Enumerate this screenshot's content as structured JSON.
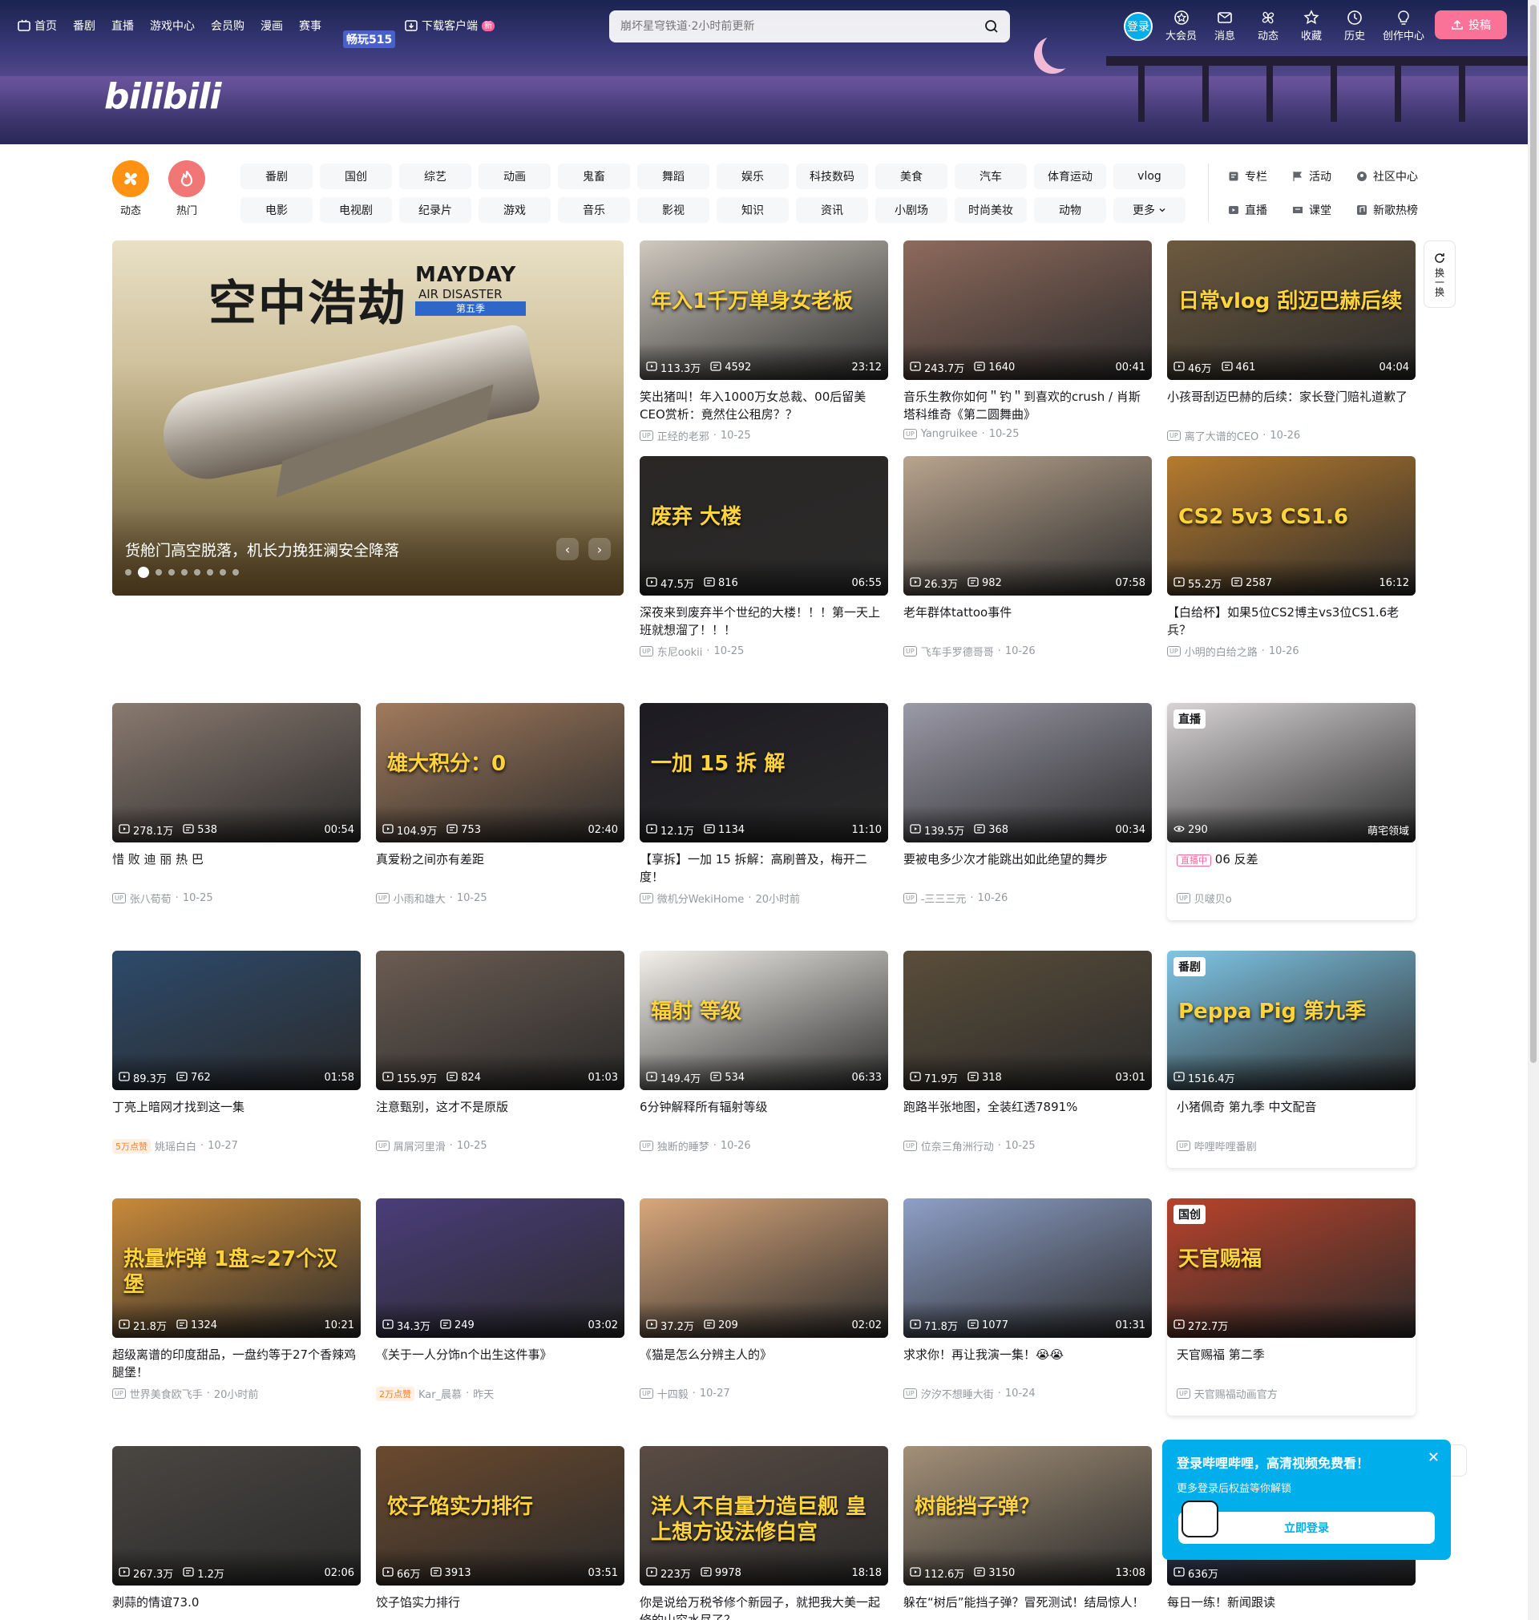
{
  "topnav": {
    "items": [
      "首页",
      "番剧",
      "直播",
      "游戏中心",
      "会员购",
      "漫画",
      "赛事"
    ],
    "event_logo": "畅玩515",
    "download": "下载客户端",
    "download_badge": "新"
  },
  "banner": {
    "logo": "bilibili"
  },
  "search": {
    "placeholder": "崩坏星穹铁道·2小时前更新"
  },
  "right_nav": {
    "login": "登录",
    "items": [
      "大会员",
      "消息",
      "动态",
      "收藏",
      "历史",
      "创作中心"
    ],
    "upload": "投稿"
  },
  "channels": {
    "main": [
      "动态",
      "热门"
    ],
    "tags": [
      "番剧",
      "国创",
      "综艺",
      "动画",
      "鬼畜",
      "舞蹈",
      "娱乐",
      "科技数码",
      "美食",
      "汽车",
      "体育运动",
      "vlog",
      "电影",
      "电视剧",
      "纪录片",
      "游戏",
      "音乐",
      "影视",
      "知识",
      "资讯",
      "小剧场",
      "时尚美妆",
      "动物",
      "更多"
    ],
    "side": [
      "专栏",
      "活动",
      "社区中心",
      "直播",
      "课堂",
      "新歌热榜"
    ]
  },
  "carousel": {
    "title_cn": "空中浩劫",
    "mayday": "MAYDAY",
    "air_disaster": "AIR DISASTER",
    "season": "第五季",
    "caption": "货舱门高空脱落，机长力挽狂澜安全降落",
    "active_dot": 1,
    "dot_count": 9
  },
  "refresh": {
    "label": "换一换"
  },
  "cards": [
    {
      "views": "113.3万",
      "danmaku": "4592",
      "duration": "23:12",
      "title": "笑出猪叫！年入1000万女总裁、00后留美CEO赏析：竟然住公租房？？",
      "up": "正经的老邪",
      "date": "10-25",
      "overlay": "年入1千万单身女老板",
      "color": "#cfc9bf"
    },
    {
      "views": "243.7万",
      "danmaku": "1640",
      "duration": "00:41",
      "title": "音乐生教你如何＂钓＂到喜欢的crush / 肖斯塔科维奇《第二圆舞曲》",
      "up": "Yangruikee",
      "date": "10-25",
      "overlay": "",
      "color": "#8e6a5c"
    },
    {
      "views": "46万",
      "danmaku": "461",
      "duration": "04:04",
      "title": "小孩哥刮迈巴赫的后续：家长登门赔礼道歉了",
      "up": "离了大谱的CEO",
      "date": "10-26",
      "overlay": "日常vlog 刮迈巴赫后续",
      "color": "#6d5a3f"
    },
    {
      "views": "47.5万",
      "danmaku": "816",
      "duration": "06:55",
      "title": "深夜来到废弃半个世纪的大楼！！！第一天上班就想溜了！！！",
      "up": "东尼ookii",
      "date": "10-25",
      "overlay": "废弃 大楼",
      "color": "#2a2725"
    },
    {
      "views": "26.3万",
      "danmaku": "982",
      "duration": "07:58",
      "title": "老年群体tattoo事件",
      "up": "飞车手罗德哥哥",
      "date": "10-26",
      "overlay": "",
      "color": "#b9a48e"
    },
    {
      "views": "55.2万",
      "danmaku": "2587",
      "duration": "16:12",
      "title": "【白给杯】如果5位CS2博主vs3位CS1.6老兵？",
      "up": "小明的白给之路",
      "date": "10-26",
      "overlay": "CS2 5v3 CS1.6",
      "color": "#b77b2e"
    },
    {
      "views": "278.1万",
      "danmaku": "538",
      "duration": "00:54",
      "title": "惜 败 迪 丽 热 巴",
      "up": "张八荀荀",
      "date": "10-25",
      "overlay": "",
      "color": "#8a7a70"
    },
    {
      "views": "104.9万",
      "danmaku": "753",
      "duration": "02:40",
      "title": "真爱粉之间亦有差距",
      "up": "小雨和雄大",
      "date": "10-25",
      "overlay": "雄大积分：0",
      "color": "#a17a5c"
    },
    {
      "views": "12.1万",
      "danmaku": "1134",
      "duration": "11:10",
      "title": "【享拆】一加 15 拆解：高刷普及，梅开二度！",
      "up": "微机分WekiHome",
      "date": "20小时前",
      "overlay": "一加 15 拆 解",
      "color": "#1d1b22"
    },
    {
      "views": "139.5万",
      "danmaku": "368",
      "duration": "00:34",
      "title": "要被电多少次才能跳出如此绝望的舞步",
      "up": "-三三三元",
      "date": "10-26",
      "overlay": "",
      "color": "#9b9aa8"
    },
    {
      "views": "290",
      "danmaku": "",
      "duration": "",
      "title": "06 反差",
      "up": "贝啵贝o",
      "date": "",
      "overlay": "",
      "color": "#d8d4d6",
      "tag": "直播",
      "live_label": "直播中",
      "uname": "萌宅领域"
    },
    {
      "views": "89.3万",
      "danmaku": "762",
      "duration": "01:58",
      "title": "丁亮上暗网才找到这一集",
      "up": "姚瑶白白",
      "date": "10-27",
      "like": "5万点赞",
      "overlay": "",
      "color": "#2d4a6b"
    },
    {
      "views": "155.9万",
      "danmaku": "824",
      "duration": "01:03",
      "title": "注意甄别，这才不是原版",
      "up": "屑屑河里滑",
      "date": "10-25",
      "overlay": "",
      "color": "#6b5c52"
    },
    {
      "views": "149.4万",
      "danmaku": "534",
      "duration": "06:33",
      "title": "6分钟解释所有辐射等级",
      "up": "独断的睡梦",
      "date": "10-26",
      "overlay": "辐射 等级",
      "color": "#f4f1ec"
    },
    {
      "views": "71.9万",
      "danmaku": "318",
      "duration": "03:01",
      "title": "跑路半张地图，全装红透7891%",
      "up": "位奈三角洲行动",
      "date": "10-25",
      "overlay": "",
      "color": "#5b4e3a"
    },
    {
      "views": "1516.4万",
      "danmaku": "",
      "duration": "",
      "title": "小猪佩奇 第九季 中文配音",
      "up": "哔哩哔哩番剧",
      "date": "",
      "overlay": "Peppa Pig 第九季",
      "color": "#7fc6e6",
      "tag": "番剧"
    },
    {
      "views": "21.8万",
      "danmaku": "1324",
      "duration": "10:21",
      "title": "超级离谱的印度甜品，一盘约等于27个香辣鸡腿堡！",
      "up": "世界美食欧飞手",
      "date": "20小时前",
      "overlay": "热量炸弹 1盘≈27个汉堡",
      "color": "#c98a3a"
    },
    {
      "views": "34.3万",
      "danmaku": "249",
      "duration": "03:02",
      "title": "《关于一人分饰n个出生这件事》",
      "up": "Kar_晨慕",
      "date": "昨天",
      "like": "2万点赞",
      "overlay": "",
      "color": "#4a3d7a"
    },
    {
      "views": "37.2万",
      "danmaku": "209",
      "duration": "02:02",
      "title": "《猫是怎么分辨主人的》",
      "up": "十四毅",
      "date": "10-27",
      "overlay": "",
      "color": "#d9a77b"
    },
    {
      "views": "71.8万",
      "danmaku": "1077",
      "duration": "01:31",
      "title": "求求你！再让我演一集！😭😭",
      "up": "汐汐不想睡大街",
      "date": "10-24",
      "overlay": "",
      "color": "#8ea0c8"
    },
    {
      "views": "272.7万",
      "danmaku": "",
      "duration": "",
      "title": "天官赐福 第二季",
      "up": "天官赐福动画官方",
      "date": "",
      "overlay": "天官赐福",
      "color": "#b8432b",
      "tag": "国创"
    },
    {
      "views": "267.3万",
      "danmaku": "1.2万",
      "duration": "02:06",
      "title": "剥蒜的情谊73.0",
      "up": "",
      "date": "",
      "overlay": "",
      "color": "#4a4642"
    },
    {
      "views": "66万",
      "danmaku": "3913",
      "duration": "03:51",
      "title": "饺子馅实力排行",
      "up": "",
      "date": "",
      "overlay": "饺子馅实力排行",
      "color": "#6b4a2e"
    },
    {
      "views": "223万",
      "danmaku": "9978",
      "duration": "18:18",
      "title": "你是说给万税爷修个新园子，就把我大美一起修的山穷水尽了？",
      "up": "",
      "date": "",
      "overlay": "洋人不自量力造巨舰 皇上想方设法修白宫",
      "color": "#5a4c44"
    },
    {
      "views": "112.6万",
      "danmaku": "3150",
      "duration": "13:08",
      "title": "躲在“树后”能挡子弹？冒死测试！结局惊人！",
      "up": "",
      "date": "",
      "overlay": "树能挡子弹？",
      "color": "#a39078"
    },
    {
      "views": "636万",
      "danmaku": "",
      "duration": "",
      "title": "每日一练！新闻跟读",
      "up": "",
      "date": "",
      "overlay": "",
      "color": "#2f3a6a"
    }
  ],
  "popup": {
    "title": "登录哔哩哔哩，高清视频免费看！",
    "subtitle": "更多登录后权益等你解锁",
    "button": "立即登录"
  }
}
